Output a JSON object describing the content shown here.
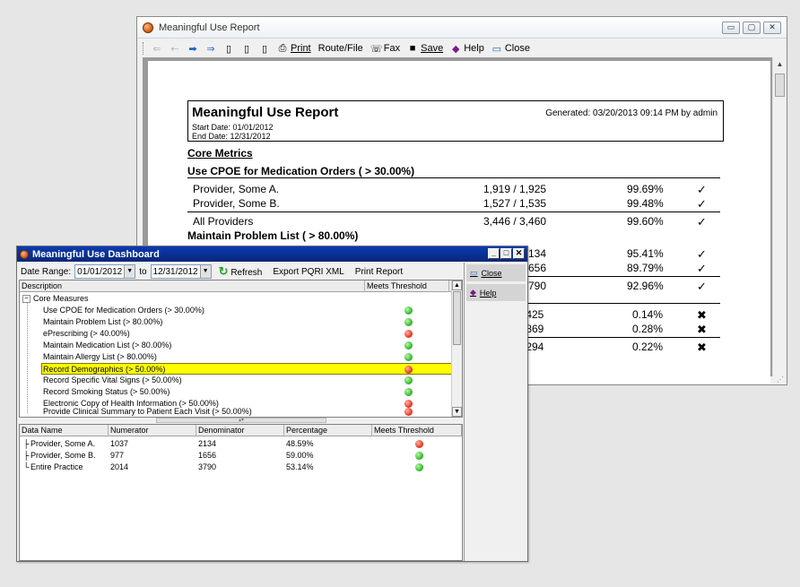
{
  "report_window": {
    "title": "Meaningful Use Report",
    "toolbar": {
      "print": "Print",
      "route_file": "Route/File",
      "fax": "Fax",
      "save": "Save",
      "help": "Help",
      "close": "Close"
    },
    "report": {
      "title": "Meaningful Use Report",
      "generated": "Generated: 03/20/2013 09:14 PM by admin",
      "start_date": "Start Date: 01/01/2012",
      "end_date": "End Date: 12/31/2012",
      "core_metrics": "Core Metrics",
      "cpoe_section": "Use CPOE for Medication Orders ( > 30.00%)",
      "problem_section": "Maintain Problem List ( > 80.00%)",
      "cpoe_rows": [
        {
          "name": "Provider, Some A.",
          "fraction": "1,919  / 1,925",
          "pct": "99.69%",
          "mark": "✓"
        },
        {
          "name": "Provider, Some B.",
          "fraction": "1,527  / 1,535",
          "pct": "99.48%",
          "mark": "✓"
        },
        {
          "name": "All Providers",
          "fraction": "3,446  / 3,460",
          "pct": "99.60%",
          "mark": "✓"
        }
      ],
      "problem_rows": [
        {
          "fraction": "134",
          "pct": "95.41%",
          "mark": "✓"
        },
        {
          "fraction": "656",
          "pct": "89.79%",
          "mark": "✓"
        },
        {
          "fraction": "790",
          "pct": "92.96%",
          "mark": "✓"
        }
      ],
      "next_rows": [
        {
          "fraction": ",425",
          "pct": "0.14%",
          "mark": "✖"
        },
        {
          "fraction": ",869",
          "pct": "0.28%",
          "mark": "✖"
        },
        {
          "fraction": ",294",
          "pct": "0.22%",
          "mark": "✖"
        }
      ]
    }
  },
  "dashboard": {
    "title": "Meaningful Use Dashboard",
    "toolbar": {
      "date_range_label": "Date Range:",
      "from_date": "01/01/2012",
      "to_label": "to",
      "to_date": "12/31/2012",
      "refresh": "Refresh",
      "export": "Export PQRI XML",
      "print": "Print Report"
    },
    "side": {
      "close": "Close",
      "help": "Help"
    },
    "measures": {
      "col_description": "Description",
      "col_meets": "Meets Threshold",
      "root": "Core Measures",
      "items": [
        {
          "label": "Use CPOE for Medication Orders (> 30.00%)",
          "status": "green"
        },
        {
          "label": "Maintain Problem List (> 80.00%)",
          "status": "green"
        },
        {
          "label": "ePrescribing (> 40.00%)",
          "status": "red"
        },
        {
          "label": "Maintain Medication List (> 80.00%)",
          "status": "green"
        },
        {
          "label": "Maintain Allergy List (> 80.00%)",
          "status": "green"
        },
        {
          "label": "Record Demographics (> 50.00%)",
          "status": "red"
        },
        {
          "label": "Record Specific Vital Signs (> 50.00%)",
          "status": "green"
        },
        {
          "label": "Record Smoking Status (> 50.00%)",
          "status": "green"
        },
        {
          "label": "Electronic Copy of Health Information (> 50.00%)",
          "status": "red"
        },
        {
          "label": "Provide Clinical Summary to Patient Each Visit (> 50.00%)",
          "status": "red"
        }
      ]
    },
    "detail": {
      "col_name": "Data Name",
      "col_numerator": "Numerator",
      "col_denominator": "Denominator",
      "col_percentage": "Percentage",
      "col_meets": "Meets Threshold",
      "rows": [
        {
          "name": "Provider, Some A.",
          "numerator": "1037",
          "denominator": "2134",
          "percentage": "48.59%",
          "status": "red"
        },
        {
          "name": "Provider, Some B.",
          "numerator": "977",
          "denominator": "1656",
          "percentage": "59.00%",
          "status": "green"
        },
        {
          "name": "Entire Practice",
          "numerator": "2014",
          "denominator": "3790",
          "percentage": "53.14%",
          "status": "green"
        }
      ]
    }
  }
}
